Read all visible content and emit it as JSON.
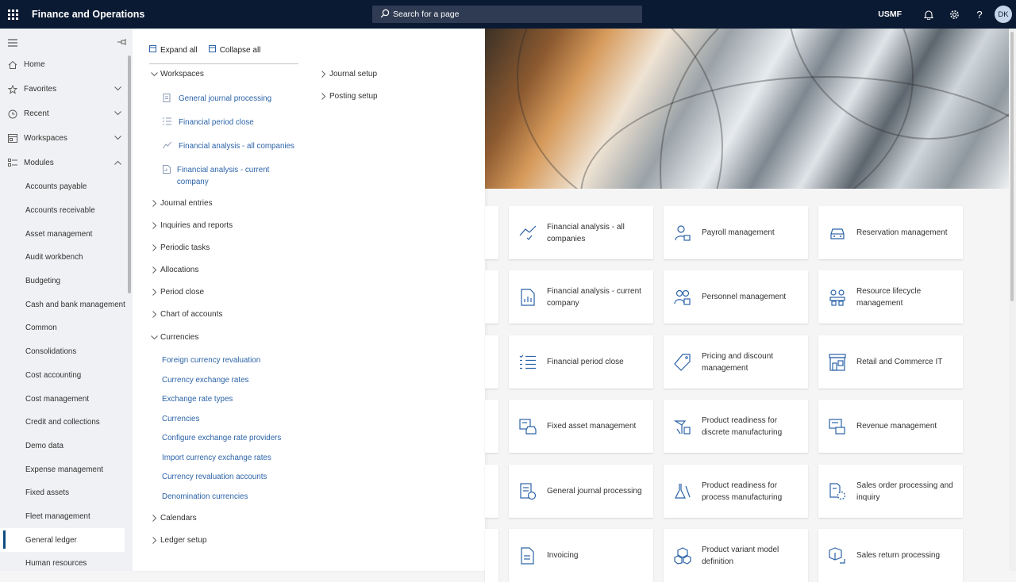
{
  "header": {
    "app_title": "Finance and Operations",
    "search_placeholder": "Search for a page",
    "company": "USMF",
    "avatar_initials": "DK",
    "help_label": "?"
  },
  "nav": {
    "items": [
      {
        "label": "Home",
        "icon": "home-icon"
      },
      {
        "label": "Favorites",
        "icon": "star-icon",
        "expandable": true
      },
      {
        "label": "Recent",
        "icon": "clock-icon",
        "expandable": true
      },
      {
        "label": "Workspaces",
        "icon": "workspace-icon",
        "expandable": true
      },
      {
        "label": "Modules",
        "icon": "list-icon",
        "expanded": true
      }
    ],
    "modules": [
      "Accounts payable",
      "Accounts receivable",
      "Asset management",
      "Audit workbench",
      "Budgeting",
      "Cash and bank management",
      "Common",
      "Consolidations",
      "Cost accounting",
      "Cost management",
      "Credit and collections",
      "Demo data",
      "Expense management",
      "Fixed assets",
      "Fleet management",
      "General ledger",
      "Human resources"
    ],
    "active_module": "General ledger"
  },
  "flyout": {
    "expand_all": "Expand all",
    "collapse_all": "Collapse all",
    "sections": {
      "workspaces": "Workspaces",
      "journal_entries": "Journal entries",
      "inquiries": "Inquiries and reports",
      "periodic": "Periodic tasks",
      "allocations": "Allocations",
      "period_close": "Period close",
      "chart": "Chart of accounts",
      "currencies": "Currencies",
      "calendars": "Calendars",
      "ledger_setup": "Ledger setup",
      "journal_setup": "Journal setup",
      "posting_setup": "Posting setup"
    },
    "workspace_links": [
      "General journal processing",
      "Financial period close",
      "Financial analysis - all companies",
      "Financial analysis - current company"
    ],
    "currency_links": [
      "Foreign currency revaluation",
      "Currency exchange rates",
      "Exchange rate types",
      "Currencies",
      "Configure exchange rate providers",
      "Import currency exchange rates",
      "Currency revaluation accounts",
      "Denomination currencies"
    ]
  },
  "tiles": [
    {
      "label": "Financial analysis - all companies",
      "icon": "trend-chart-icon"
    },
    {
      "label": "Payroll management",
      "icon": "payroll-people-icon"
    },
    {
      "label": "Reservation management",
      "icon": "car-icon"
    },
    {
      "label": "Financial analysis - current company",
      "icon": "document-chart-icon"
    },
    {
      "label": "Personnel management",
      "icon": "people-group-icon"
    },
    {
      "label": "Resource lifecycle management",
      "icon": "resource-people-icon"
    },
    {
      "label": "Financial period close",
      "icon": "checklist-icon"
    },
    {
      "label": "Pricing and discount management",
      "icon": "price-tag-icon"
    },
    {
      "label": "Retail and Commerce IT",
      "icon": "store-icon"
    },
    {
      "label": "Fixed asset management",
      "icon": "asset-car-icon"
    },
    {
      "label": "Product readiness for discrete manufacturing",
      "icon": "product-tools-icon"
    },
    {
      "label": "Revenue management",
      "icon": "revenue-icon"
    },
    {
      "label": "General journal processing",
      "icon": "journal-icon"
    },
    {
      "label": "Product readiness for process manufacturing",
      "icon": "flask-icon"
    },
    {
      "label": "Sales order processing and inquiry",
      "icon": "sales-order-icon"
    },
    {
      "label": "Invoicing",
      "icon": "invoice-icon"
    },
    {
      "label": "Product variant model definition",
      "icon": "cubes-icon"
    },
    {
      "label": "Sales return processing",
      "icon": "box-return-icon"
    }
  ]
}
